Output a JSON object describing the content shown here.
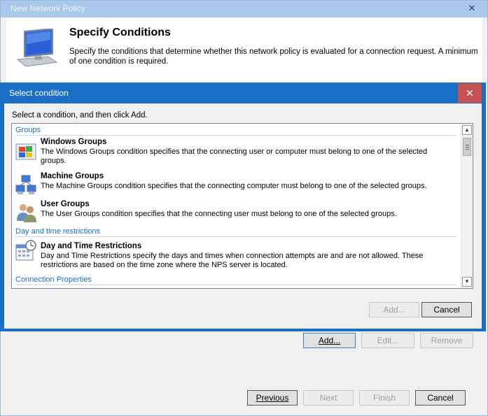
{
  "parent": {
    "title": "New Network Policy",
    "close_glyph": "✕",
    "header_title": "Specify Conditions",
    "header_desc": "Specify the conditions that determine whether this network policy is evaluated for a connection request. A minimum of one condition is required.",
    "buttons": {
      "add": "Add...",
      "edit": "Edit...",
      "remove": "Remove",
      "previous": "Previous",
      "next": "Next",
      "finish": "Finish",
      "cancel": "Cancel"
    }
  },
  "dialog": {
    "title": "Select condition",
    "close_glyph": "✕",
    "instruction": "Select a condition, and then click Add.",
    "groups": [
      {
        "header": "Groups",
        "items": [
          {
            "name": "Windows Groups",
            "desc": "The Windows Groups condition specifies that the connecting user or computer must belong to one of the selected groups.",
            "icon": "windows-groups-icon"
          },
          {
            "name": "Machine Groups",
            "desc": "The Machine Groups condition specifies that the connecting computer must belong to one of the selected groups.",
            "icon": "machine-groups-icon"
          },
          {
            "name": "User Groups",
            "desc": "The User Groups condition specifies that the connecting user must belong to one of the selected groups.",
            "icon": "user-groups-icon"
          }
        ]
      },
      {
        "header": "Day and time restrictions",
        "items": [
          {
            "name": "Day and Time Restrictions",
            "desc": "Day and Time Restrictions specify the days and times when connection attempts are and are not allowed. These restrictions are based on the time zone where the NPS server is located.",
            "icon": "calendar-clock-icon"
          }
        ]
      },
      {
        "header": "Connection Properties",
        "items": []
      }
    ],
    "buttons": {
      "add": "Add...",
      "cancel": "Cancel"
    }
  }
}
